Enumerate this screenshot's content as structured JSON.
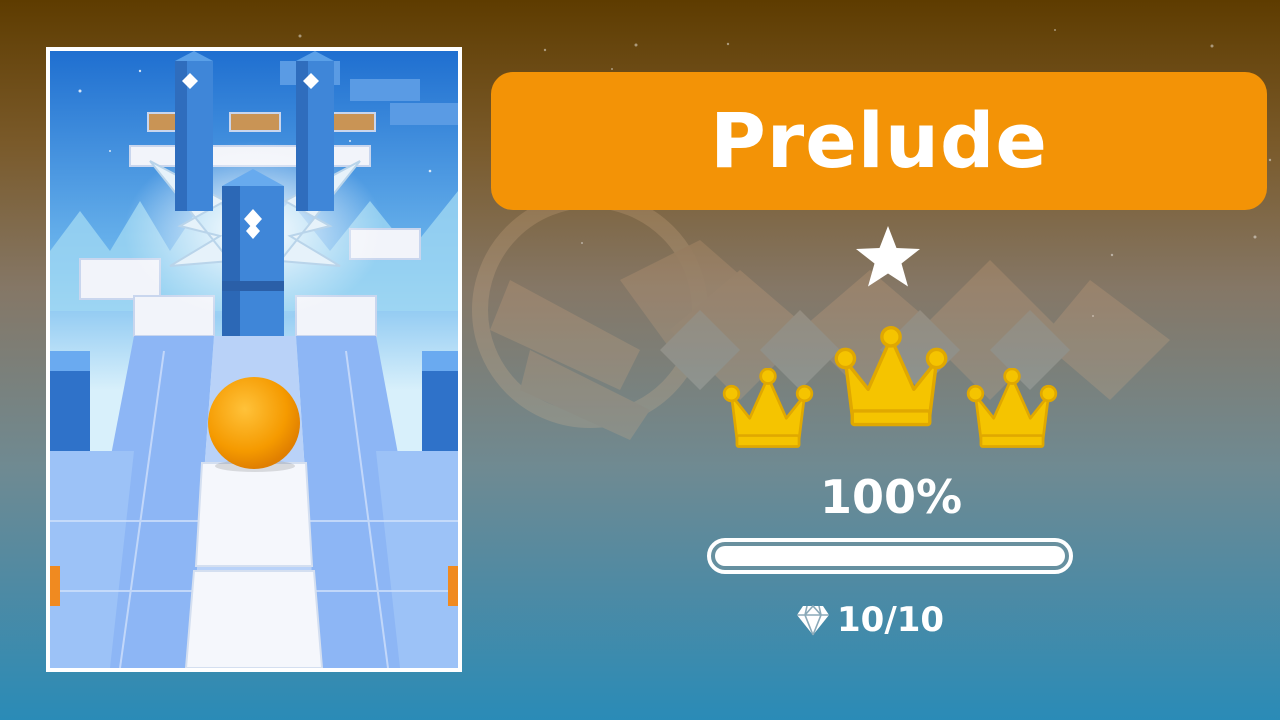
{
  "level": {
    "title": "Prelude",
    "stars_earned": 1,
    "crowns_earned": 3,
    "crowns_total": 3,
    "percent_label": "100%",
    "progress": 1.0,
    "gems_label": "10/10"
  },
  "colors": {
    "banner": "#f39306",
    "crown": "#f5c400",
    "ball": "#f5a000",
    "sky": "#2a7fd4",
    "text": "#ffffff"
  },
  "icons": {
    "star": "star-icon",
    "crown": "crown-icon",
    "gem": "diamond-icon"
  }
}
